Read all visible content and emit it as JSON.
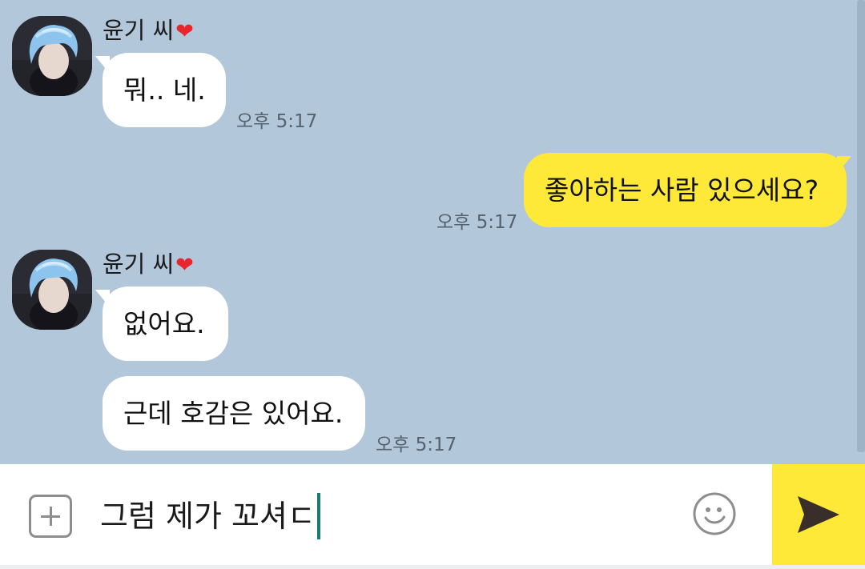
{
  "chat": {
    "messages": [
      {
        "sender": "윤기 씨",
        "text": "뭐.. 네.",
        "time": "오후 5:17"
      },
      {
        "text": "좋아하는 사람 있으세요?",
        "time": "오후 5:17"
      },
      {
        "sender": "윤기 씨",
        "text": "없어요."
      },
      {
        "text": "근데 호감은 있어요.",
        "time": "오후 5:17"
      }
    ]
  },
  "input": {
    "value": "그럼 제가 꼬셔ㄷ"
  },
  "icons": {
    "attach": "plus-square-icon",
    "emoji": "smiley-icon",
    "send": "send-arrow-icon",
    "heart": "red-heart-icon"
  },
  "colors": {
    "chat_background": "#b2c7da",
    "incoming_bubble": "#ffffff",
    "outgoing_bubble": "#fee838",
    "send_button": "#fee838",
    "caret": "#1b7a6e"
  }
}
